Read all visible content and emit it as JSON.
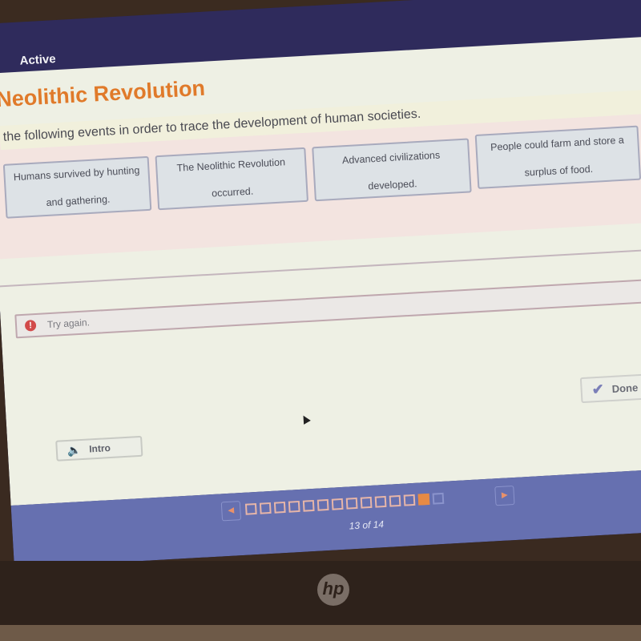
{
  "topbar": {
    "status_label": "Active"
  },
  "lesson": {
    "title": "Neolithic Revolution",
    "instructions": "the following events in order to trace the development of human societies."
  },
  "tiles": [
    {
      "label": "Humans survived by hunting and gathering."
    },
    {
      "label": "The Neolithic Revolution occurred."
    },
    {
      "label": "Advanced civilizations developed."
    },
    {
      "label": "People could farm and store a surplus of food."
    }
  ],
  "feedback": {
    "icon": "alert-icon",
    "text": "Try again."
  },
  "buttons": {
    "done_label": "Done",
    "intro_label": "Intro"
  },
  "navigation": {
    "current_page": 13,
    "total_pages": 14,
    "page_count_text": "13 of 14",
    "prev_icon": "triangle-left-icon",
    "next_icon": "triangle-right-icon"
  },
  "colors": {
    "accent_orange": "#e07a2a",
    "nav_blue": "#6670b0",
    "topbar_navy": "#2f2b5c",
    "alert_red": "#d24a4a"
  },
  "device": {
    "brand_logo": "hp"
  }
}
